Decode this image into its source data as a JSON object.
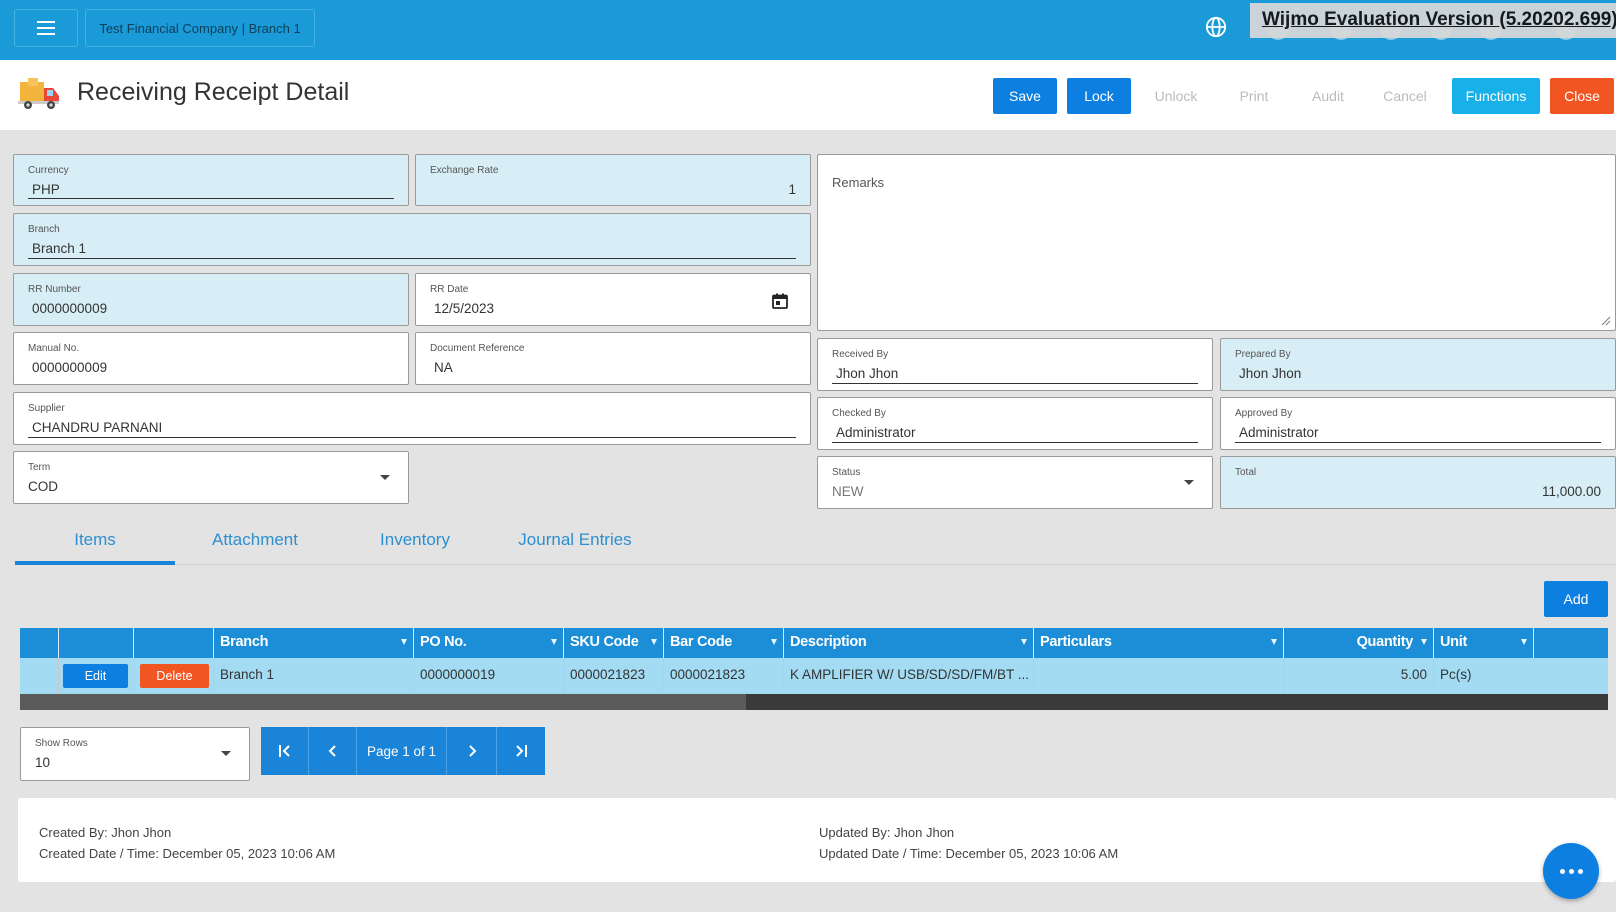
{
  "topbar": {
    "company": "Test Financial Company | Branch 1",
    "watermark": "Wijmo Evaluation Version (5.20202.699)"
  },
  "header": {
    "title": "Receiving Receipt Detail",
    "buttons": {
      "save": "Save",
      "lock": "Lock",
      "unlock": "Unlock",
      "print": "Print",
      "audit": "Audit",
      "cancel": "Cancel",
      "functions": "Functions",
      "close": "Close"
    }
  },
  "form": {
    "currency": {
      "label": "Currency",
      "value": "PHP"
    },
    "exchange_rate": {
      "label": "Exchange Rate",
      "value": "1"
    },
    "branch": {
      "label": "Branch",
      "value": "Branch 1"
    },
    "rr_number": {
      "label": "RR Number",
      "value": "0000000009"
    },
    "rr_date": {
      "label": "RR Date",
      "value": "12/5/2023"
    },
    "manual_no": {
      "label": "Manual No.",
      "value": "0000000009"
    },
    "document_reference": {
      "label": "Document Reference",
      "value": "NA"
    },
    "supplier": {
      "label": "Supplier",
      "value": "CHANDRU PARNANI"
    },
    "term": {
      "label": "Term",
      "value": "COD"
    },
    "remarks": {
      "label": "Remarks",
      "value": ""
    },
    "received_by": {
      "label": "Received By",
      "value": "Jhon Jhon"
    },
    "prepared_by": {
      "label": "Prepared By",
      "value": "Jhon Jhon"
    },
    "checked_by": {
      "label": "Checked By",
      "value": "Administrator"
    },
    "approved_by": {
      "label": "Approved By",
      "value": "Administrator"
    },
    "status": {
      "label": "Status",
      "value": "NEW"
    },
    "total": {
      "label": "Total",
      "value": "11,000.00"
    }
  },
  "tabs": [
    "Items",
    "Attachment",
    "Inventory",
    "Journal Entries"
  ],
  "add_label": "Add",
  "grid": {
    "columns": [
      "Branch",
      "PO No.",
      "SKU Code",
      "Bar Code",
      "Description",
      "Particulars",
      "Quantity",
      "Unit"
    ],
    "rows": [
      {
        "edit": "Edit",
        "delete": "Delete",
        "branch": "Branch 1",
        "po_no": "0000000019",
        "sku_code": "0000021823",
        "bar_code": "0000021823",
        "description": "K AMPLIFIER W/ USB/SD/SD/FM/BT ...",
        "particulars": "",
        "quantity": "5.00",
        "unit": "Pc(s)"
      }
    ]
  },
  "pager": {
    "show_rows_label": "Show Rows",
    "show_rows_value": "10",
    "page_text": "Page 1 of 1"
  },
  "footer": {
    "created_by": "Created By: Jhon Jhon",
    "created_date": "Created Date / Time: December 05, 2023 10:06 AM",
    "updated_by": "Updated By: Jhon Jhon",
    "updated_date": "Updated Date / Time: December 05, 2023 10:06 AM"
  },
  "colors": {
    "topbar": "#1a9ad6",
    "primary": "#0d7fe0",
    "info": "#17b0e8",
    "danger": "#f05522",
    "grid_header": "#1c8ed8",
    "field_bg": "#d8eef7"
  }
}
